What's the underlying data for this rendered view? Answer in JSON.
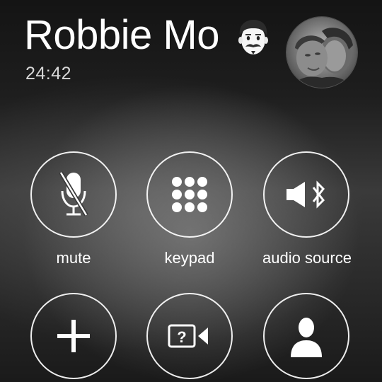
{
  "call": {
    "caller_name": "Robbie Mo",
    "duration": "24:42"
  },
  "controls": [
    {
      "id": "mute",
      "label": "mute",
      "icon": "muted-microphone-icon"
    },
    {
      "id": "keypad",
      "label": "keypad",
      "icon": "keypad-grid-icon"
    },
    {
      "id": "audio-source",
      "label": "audio source",
      "icon": "speaker-bluetooth-icon"
    },
    {
      "id": "add-call",
      "label": "",
      "icon": "plus-icon"
    },
    {
      "id": "facetime",
      "label": "",
      "icon": "facetime-unknown-icon"
    },
    {
      "id": "contacts",
      "label": "",
      "icon": "contact-silhouette-icon"
    }
  ],
  "colors": {
    "text": "#ffffff",
    "ring": "#ffffff",
    "background": "#2a2a2a"
  }
}
